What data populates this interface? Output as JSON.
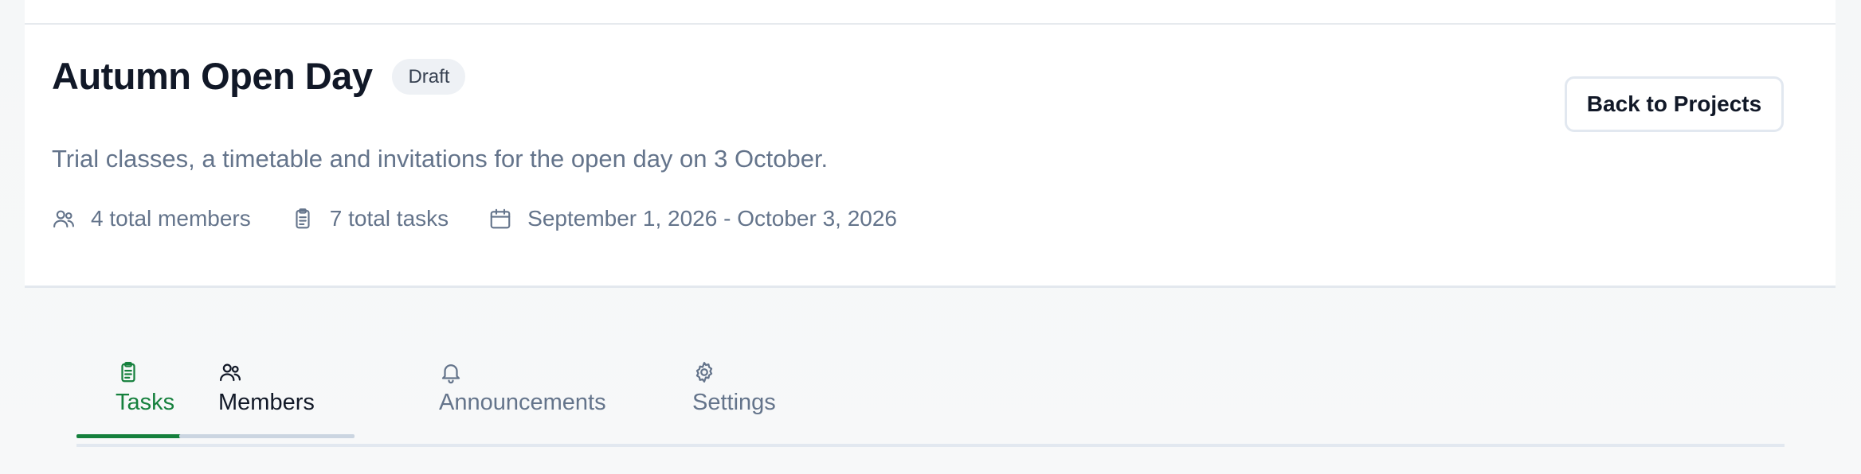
{
  "project": {
    "title": "Autumn Open Day",
    "status_badge": "Draft",
    "description": "Trial classes, a timetable and invitations for the open day on 3 October.",
    "meta": {
      "members": "4 total members",
      "tasks": "7 total tasks",
      "date_range": "September 1, 2026 - October 3, 2026"
    }
  },
  "actions": {
    "back_label": "Back to Projects"
  },
  "tabs": [
    {
      "label": "Tasks",
      "icon": "clipboard-icon",
      "state": "active"
    },
    {
      "label": "Members",
      "icon": "users-icon",
      "state": "hover"
    },
    {
      "label": "Announcements",
      "icon": "bell-icon",
      "state": "idle"
    },
    {
      "label": "Settings",
      "icon": "gear-icon",
      "state": "idle"
    }
  ],
  "colors": {
    "accent": "#15803d",
    "title": "#111827",
    "muted": "#64748b",
    "border": "#e2e8f0",
    "badge_bg": "#eef1f5"
  }
}
